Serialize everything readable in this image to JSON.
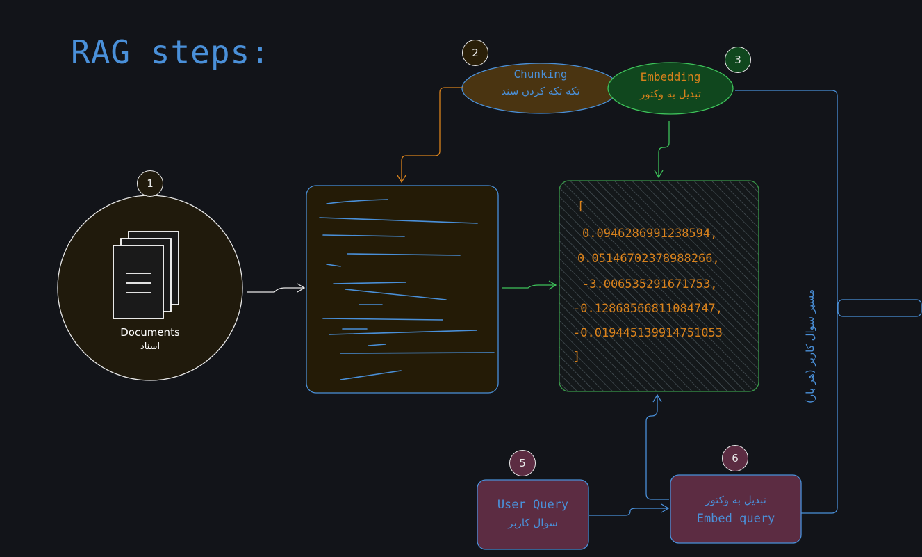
{
  "title": "RAG steps:",
  "steps": {
    "documents": {
      "number": "1",
      "label_en": "Documents",
      "label_fa": "اسناد"
    },
    "chunking": {
      "number": "2",
      "label_en": "Chunking",
      "label_fa": "تکه تکه کردن سند"
    },
    "embedding": {
      "number": "3",
      "label_en": "Embedding",
      "label_fa": "تبدیل به وکتور"
    },
    "user_query": {
      "number": "5",
      "label_en": "User Query",
      "label_fa": "سوال کاربر"
    },
    "embed_query": {
      "number": "6",
      "label_fa": "تبدیل به وکتور",
      "label_en": "Embed query"
    }
  },
  "vector": {
    "open": "[",
    "values": [
      "0.0946286991238594,",
      "0.05146702378988266,",
      "-3.006535291671753,",
      "-0.12868566811084747,",
      "-0.019445139914751053"
    ],
    "close": "]"
  },
  "query_path_label": "مسیر سوال کاربر (هر بار)",
  "colors": {
    "background": "#121419",
    "blue": "#4a90d9",
    "orange": "#d9821c",
    "green": "#3a9a4a",
    "brown_fill": "#2a1f08",
    "query_fill": "#5c2c42"
  }
}
